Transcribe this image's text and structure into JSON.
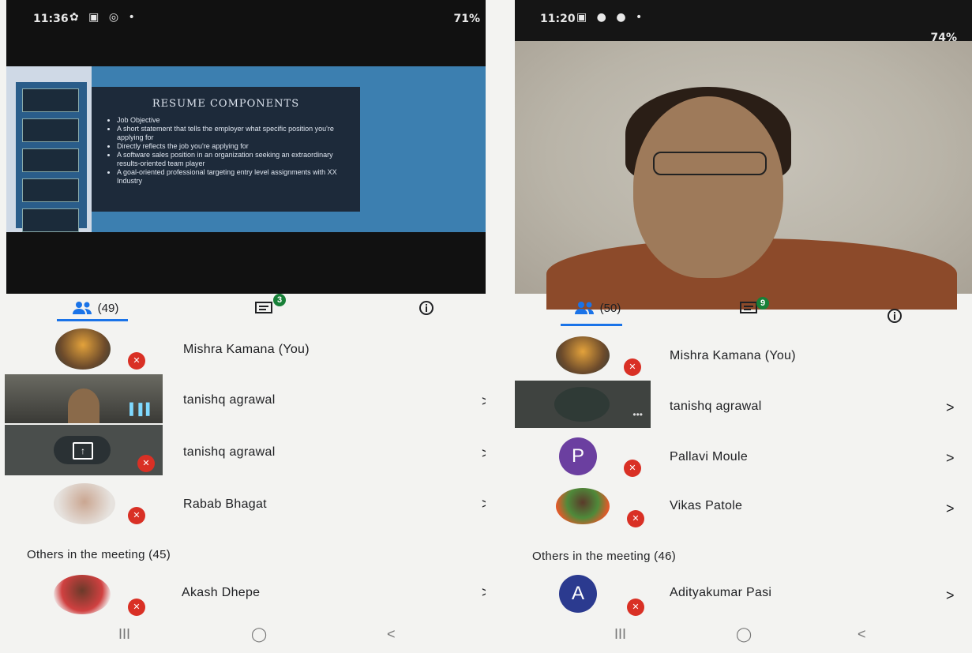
{
  "left": {
    "status": {
      "time": "11:36",
      "icons": "✿ ▣ ◎ •",
      "battery": "71%"
    },
    "slide": {
      "title": "RESUME COMPONENTS",
      "bullets": [
        "Job Objective",
        "A short statement that tells the employer what specific position you're applying for",
        "Directly reflects the job you're applying for",
        "A software sales position in an organization seeking an extraordinary results-oriented team player",
        "A goal-oriented professional targeting entry level assignments with XX Industry"
      ]
    },
    "tabs": {
      "people_count": "(49)",
      "chat_badge": "3"
    },
    "participants": [
      {
        "name": "Mishra Kamana (You)"
      },
      {
        "name": "tanishq agrawal"
      },
      {
        "name": "tanishq agrawal"
      },
      {
        "name": "Rabab Bhagat"
      }
    ],
    "others_label": "Others in the meeting (45)",
    "others": [
      {
        "name": "Akash Dhepe"
      }
    ],
    "chevron": ">"
  },
  "right": {
    "status": {
      "time": "11:20",
      "icons": "▣ ● ● •",
      "battery": "74%"
    },
    "tabs": {
      "people_count": "(50)",
      "chat_badge": "9"
    },
    "participants": [
      {
        "name": "Mishra Kamana (You)"
      },
      {
        "name": "tanishq agrawal"
      },
      {
        "name": "Pallavi Moule",
        "initial": "P"
      },
      {
        "name": "Vikas Patole"
      }
    ],
    "others_label": "Others in the meeting (46)",
    "others": [
      {
        "name": "Adityakumar Pasi",
        "initial": "A"
      }
    ],
    "chevron": ">"
  },
  "nav": {
    "recents": "III",
    "home": "◯",
    "back": "<"
  },
  "colors": {
    "mute": "#d93025",
    "chat_badge": "#188038",
    "tab_underline": "#1a73e8",
    "avatar_purple": "#6b3fa0",
    "avatar_navy": "#2b3a8f"
  },
  "icons": [
    "people-icon",
    "chat-icon",
    "info-icon",
    "mic-off-icon",
    "chevron-right-icon",
    "present-screen-icon",
    "audio-level-icon"
  ]
}
